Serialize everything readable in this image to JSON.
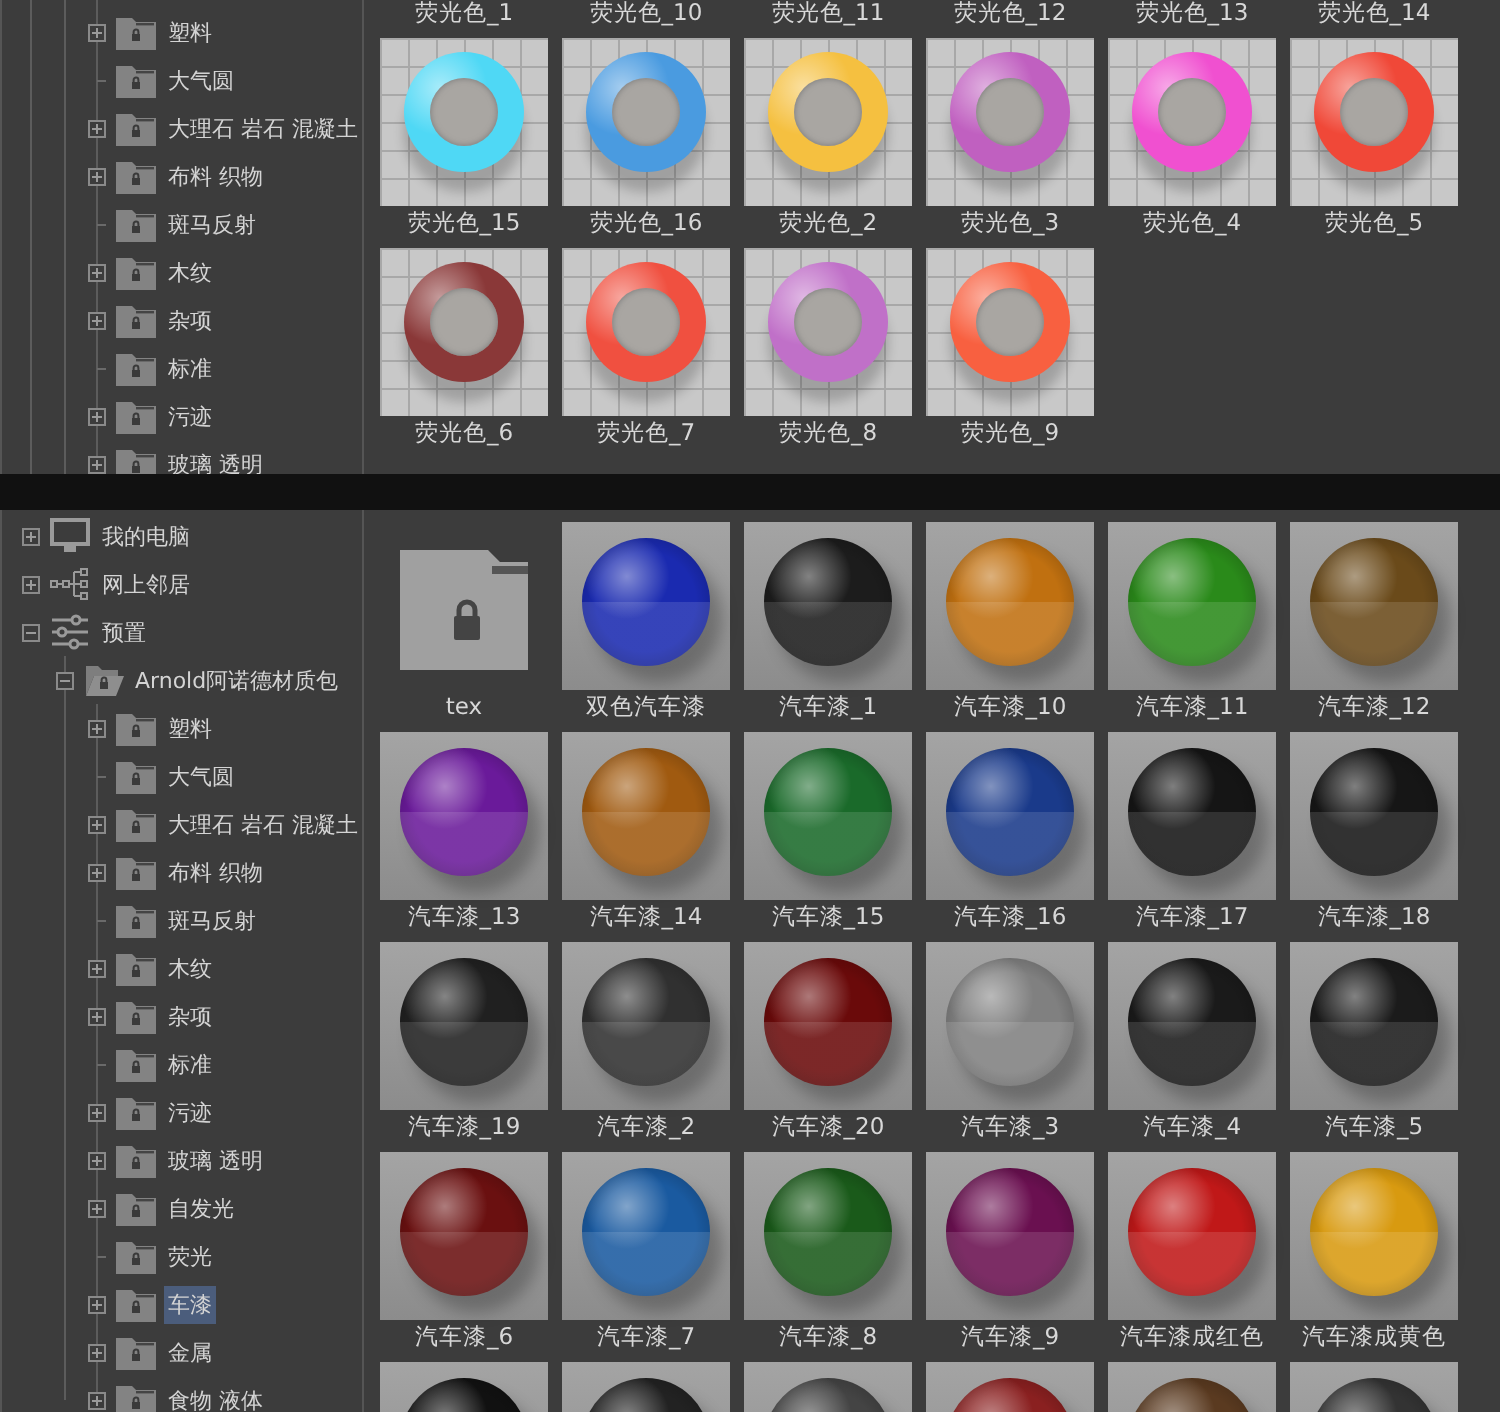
{
  "top_panel": {
    "tree": [
      {
        "label": "塑料",
        "expandable": true,
        "expanded": false,
        "selected": false
      },
      {
        "label": "大气圆",
        "expandable": false,
        "selected": false
      },
      {
        "label": "大理石 岩石 混凝土",
        "expandable": true,
        "expanded": false,
        "selected": false
      },
      {
        "label": "布料 织物",
        "expandable": true,
        "expanded": false,
        "selected": false
      },
      {
        "label": "斑马反射",
        "expandable": false,
        "selected": false
      },
      {
        "label": "木纹",
        "expandable": true,
        "expanded": false,
        "selected": false
      },
      {
        "label": "杂项",
        "expandable": true,
        "expanded": false,
        "selected": false
      },
      {
        "label": "标准",
        "expandable": false,
        "selected": false
      },
      {
        "label": "污迹",
        "expandable": true,
        "expanded": false,
        "selected": false
      },
      {
        "label": "玻璃 透明",
        "expandable": true,
        "expanded": false,
        "selected": false
      }
    ],
    "grid": [
      {
        "kind": "label_only",
        "label": "荧光色_1"
      },
      {
        "kind": "label_only",
        "label": "荧光色_10"
      },
      {
        "kind": "label_only",
        "label": "荧光色_11"
      },
      {
        "kind": "label_only",
        "label": "荧光色_12"
      },
      {
        "kind": "label_only",
        "label": "荧光色_13"
      },
      {
        "kind": "label_only",
        "label": "荧光色_14"
      },
      {
        "kind": "ring",
        "label": "荧光色_15",
        "color": "#4fd8f5"
      },
      {
        "kind": "ring",
        "label": "荧光色_16",
        "color": "#4a9be0"
      },
      {
        "kind": "ring",
        "label": "荧光色_2",
        "color": "#f5c040"
      },
      {
        "kind": "ring",
        "label": "荧光色_3",
        "color": "#c060c0"
      },
      {
        "kind": "ring",
        "label": "荧光色_4",
        "color": "#f050d0"
      },
      {
        "kind": "ring",
        "label": "荧光色_5",
        "color": "#f04838"
      },
      {
        "kind": "ring",
        "label": "荧光色_6",
        "color": "#8a3838"
      },
      {
        "kind": "ring",
        "label": "荧光色_7",
        "color": "#f05040"
      },
      {
        "kind": "ring",
        "label": "荧光色_8",
        "color": "#c070c8"
      },
      {
        "kind": "ring",
        "label": "荧光色_9",
        "color": "#f86040"
      }
    ]
  },
  "bottom_panel": {
    "tree": [
      {
        "label": "我的电脑",
        "expandable": true,
        "expanded": false,
        "selected": false,
        "kind": "computer"
      },
      {
        "label": "网上邻居",
        "expandable": true,
        "expanded": false,
        "selected": false,
        "kind": "network"
      },
      {
        "label": "预置",
        "expandable": true,
        "expanded": true,
        "selected": false,
        "kind": "presets",
        "children": [
          {
            "label": "Arnold阿诺德材质包",
            "expandable": true,
            "expanded": true,
            "selected": false,
            "children": [
              {
                "label": "塑料",
                "expandable": true,
                "expanded": false,
                "selected": false
              },
              {
                "label": "大气圆",
                "expandable": false,
                "selected": false
              },
              {
                "label": "大理石 岩石 混凝土",
                "expandable": true,
                "expanded": false,
                "selected": false
              },
              {
                "label": "布料 织物",
                "expandable": true,
                "expanded": false,
                "selected": false
              },
              {
                "label": "斑马反射",
                "expandable": false,
                "selected": false
              },
              {
                "label": "木纹",
                "expandable": true,
                "expanded": false,
                "selected": false
              },
              {
                "label": "杂项",
                "expandable": true,
                "expanded": false,
                "selected": false
              },
              {
                "label": "标准",
                "expandable": false,
                "selected": false
              },
              {
                "label": "污迹",
                "expandable": true,
                "expanded": false,
                "selected": false
              },
              {
                "label": "玻璃 透明",
                "expandable": true,
                "expanded": false,
                "selected": false
              },
              {
                "label": "自发光",
                "expandable": true,
                "expanded": false,
                "selected": false
              },
              {
                "label": "荧光",
                "expandable": false,
                "selected": false
              },
              {
                "label": "车漆",
                "expandable": true,
                "expanded": false,
                "selected": true
              },
              {
                "label": "金属",
                "expandable": true,
                "expanded": false,
                "selected": false
              },
              {
                "label": "食物 液体",
                "expandable": true,
                "expanded": false,
                "selected": false
              }
            ]
          }
        ]
      }
    ],
    "grid": [
      {
        "kind": "folder",
        "label": "tex"
      },
      {
        "kind": "sphere",
        "label": "双色汽车漆",
        "color": "#1a2ab0"
      },
      {
        "kind": "sphere",
        "label": "汽车漆_1",
        "color": "#1c1c1c"
      },
      {
        "kind": "sphere",
        "label": "汽车漆_10",
        "color": "#c07010"
      },
      {
        "kind": "sphere",
        "label": "汽车漆_11",
        "color": "#2a8a1a"
      },
      {
        "kind": "sphere",
        "label": "汽车漆_12",
        "color": "#6a4a1a"
      },
      {
        "kind": "sphere",
        "label": "汽车漆_13",
        "color": "#6a1a9a"
      },
      {
        "kind": "sphere",
        "label": "汽车漆_14",
        "color": "#a05a10"
      },
      {
        "kind": "sphere",
        "label": "汽车漆_15",
        "color": "#1a6a2a"
      },
      {
        "kind": "sphere",
        "label": "汽车漆_16",
        "color": "#1a3a8a"
      },
      {
        "kind": "sphere",
        "label": "汽车漆_17",
        "color": "#151515"
      },
      {
        "kind": "sphere",
        "label": "汽车漆_18",
        "color": "#161616"
      },
      {
        "kind": "sphere",
        "label": "汽车漆_19",
        "color": "#202020"
      },
      {
        "kind": "sphere",
        "label": "汽车漆_2",
        "color": "#303030"
      },
      {
        "kind": "sphere",
        "label": "汽车漆_20",
        "color": "#6a0a0a"
      },
      {
        "kind": "sphere",
        "label": "汽车漆_3",
        "color": "#808080"
      },
      {
        "kind": "sphere",
        "label": "汽车漆_4",
        "color": "#1a1a1a"
      },
      {
        "kind": "sphere",
        "label": "汽车漆_5",
        "color": "#1b1b1b"
      },
      {
        "kind": "sphere",
        "label": "汽车漆_6",
        "color": "#6a1010"
      },
      {
        "kind": "sphere",
        "label": "汽车漆_7",
        "color": "#1a5aa0"
      },
      {
        "kind": "sphere",
        "label": "汽车漆_8",
        "color": "#1a5a1a"
      },
      {
        "kind": "sphere",
        "label": "汽车漆_9",
        "color": "#6a1050"
      },
      {
        "kind": "sphere",
        "label": "汽车漆成红色",
        "color": "#c01818"
      },
      {
        "kind": "sphere",
        "label": "汽车漆成黄色",
        "color": "#d89a10"
      },
      {
        "kind": "sphere",
        "color": "#111111"
      },
      {
        "kind": "sphere",
        "color": "#222222"
      },
      {
        "kind": "sphere",
        "color": "#444444"
      },
      {
        "kind": "sphere",
        "color": "#8a2020"
      },
      {
        "kind": "sphere",
        "color": "#5a3a20"
      },
      {
        "kind": "sphere",
        "color": "#333333"
      }
    ]
  }
}
